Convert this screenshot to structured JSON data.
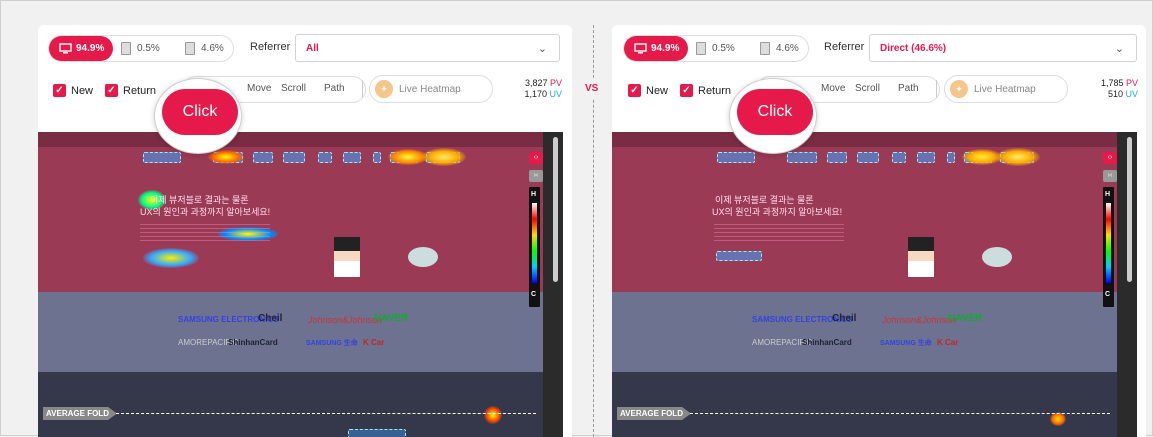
{
  "vs_label": "VS",
  "panels": [
    {
      "devices": {
        "desktop": "94.9%",
        "tablet": "0.5%",
        "mobile": "4.6%"
      },
      "referrer_label": "Referrer",
      "referrer_value": "All",
      "filters": {
        "new": "New",
        "return": "Return"
      },
      "modes": {
        "click": "Click",
        "move": "Move",
        "scroll": "Scroll",
        "path": "Path"
      },
      "live": "Live Heatmap",
      "stats": {
        "pv_value": "3,827",
        "pv_label": "PV",
        "uv_value": "1,170",
        "uv_label": "UV"
      },
      "fold": "AVERAGE FOLD"
    },
    {
      "devices": {
        "desktop": "94.9%",
        "tablet": "0.5%",
        "mobile": "4.6%"
      },
      "referrer_label": "Referrer",
      "referrer_value": "Direct (46.6%)",
      "filters": {
        "new": "New",
        "return": "Return"
      },
      "modes": {
        "click": "Click",
        "move": "Move",
        "scroll": "Scroll",
        "path": "Path"
      },
      "live": "Live Heatmap",
      "stats": {
        "pv_value": "1,785",
        "pv_label": "PV",
        "uv_value": "510",
        "uv_label": "UV"
      },
      "fold": "AVERAGE FOLD"
    }
  ],
  "page": {
    "headline1": "이제 뷰저블로 결과는 물론",
    "headline2": "UX의 원인과 과정까지 알아보세요!",
    "brands": [
      "SAMSUNG ELECTRONICS",
      "Cheil",
      "Johnson&Johnson",
      "NAVER",
      "AMOREPACIFIC",
      "ShinhanCard",
      "SAMSUNG 生命",
      "K Car"
    ],
    "scale_high": "H",
    "scale_low": "C"
  },
  "colors": {
    "accent": "#e6194b",
    "uv": "#1bb3c8"
  }
}
